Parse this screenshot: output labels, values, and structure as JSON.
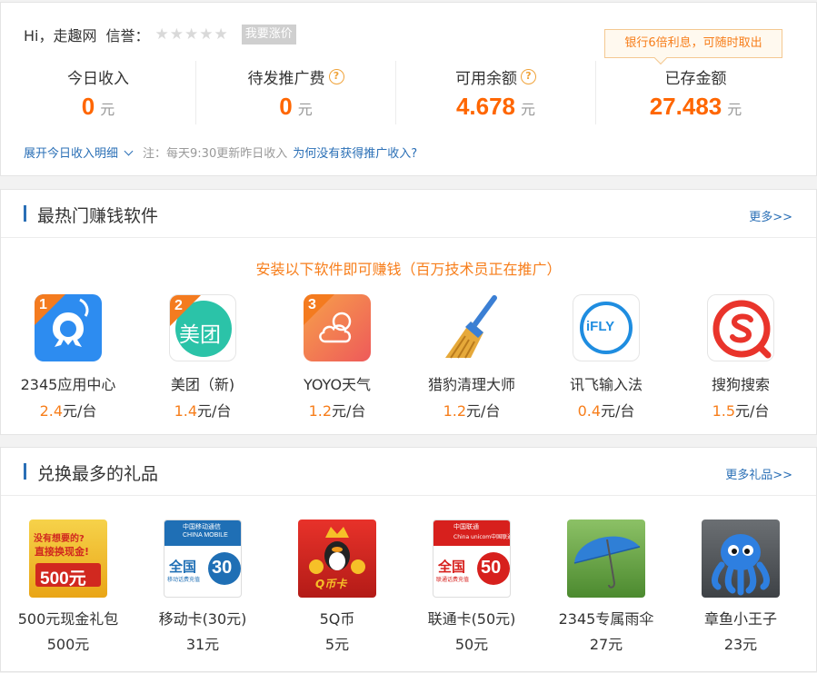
{
  "account": {
    "greeting": "Hi，走趣网",
    "credit_label": "信誉：",
    "raise_button": "我要涨价",
    "tooltip": "银行6倍利息，可随时取出",
    "stats": [
      {
        "label": "今日收入",
        "value": "0",
        "unit": "元",
        "help": false
      },
      {
        "label": "待发推广费",
        "value": "0",
        "unit": "元",
        "help": true
      },
      {
        "label": "可用余额",
        "value": "4.678",
        "unit": "元",
        "help": true
      },
      {
        "label": "已存金额",
        "value": "27.483",
        "unit": "元",
        "help": false
      }
    ],
    "rating_stars": 0,
    "expand_link": "展开今日收入明细",
    "note": "注：每天9:30更新昨日收入",
    "why_link": "为何没有获得推广收入?"
  },
  "apps": {
    "title": "最热门赚钱软件",
    "more": "更多>>",
    "banner": "安装以下软件即可赚钱（百万技术员正在推广）",
    "items": [
      {
        "name": "2345应用中心",
        "price": "2.4",
        "unit": "元/台",
        "rank": "1"
      },
      {
        "name": "美团（新)",
        "price": "1.4",
        "unit": "元/台",
        "rank": "2",
        "icon_text": "美团"
      },
      {
        "name": "YOYO天气",
        "price": "1.2",
        "unit": "元/台",
        "rank": "3"
      },
      {
        "name": "猎豹清理大师",
        "price": "1.2",
        "unit": "元/台"
      },
      {
        "name": "讯飞输入法",
        "price": "0.4",
        "unit": "元/台",
        "icon_text": "iFLY"
      },
      {
        "name": "搜狗搜索",
        "price": "1.5",
        "unit": "元/台"
      }
    ]
  },
  "gifts": {
    "title": "兑换最多的礼品",
    "more": "更多礼品>>",
    "items": [
      {
        "name": "500元现金礼包",
        "price": "500元",
        "icon_lines": [
          "没有想要的?",
          "直接换现金!",
          "500元"
        ]
      },
      {
        "name": "移动卡(30元)",
        "price": "31元",
        "icon_lines": [
          "中国移动通信",
          "CHINA MOBILE",
          "全国",
          "移动话费充值",
          "30"
        ]
      },
      {
        "name": "5Q币",
        "price": "5元",
        "icon_lines": [
          "Q币卡"
        ]
      },
      {
        "name": "联通卡(50元)",
        "price": "50元",
        "icon_lines": [
          "中国联通",
          "China unicom中国联通",
          "全国",
          "联通话费充值",
          "50"
        ]
      },
      {
        "name": "2345专属雨伞",
        "price": "27元"
      },
      {
        "name": "章鱼小王子",
        "price": "23元"
      }
    ]
  },
  "colors": {
    "accent": "#ff6600",
    "link": "#2a6fb6",
    "orange_text": "#f77e1b"
  }
}
